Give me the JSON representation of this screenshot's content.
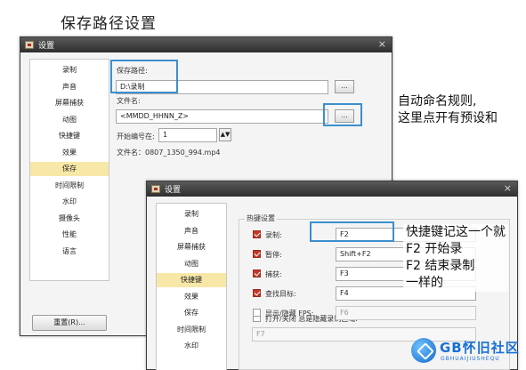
{
  "caption_top": "保存路径设置",
  "dialog1": {
    "title": "设置",
    "close": "×",
    "nav": [
      "录制",
      "声音",
      "屏幕捕获",
      "动图",
      "快捷键",
      "效果",
      "保存",
      "时间限制",
      "水印",
      "摄像头",
      "性能",
      "语言"
    ],
    "active_index": 6,
    "save_path_label": "保存路径:",
    "save_path_value": "D:\\录制",
    "filename_label": "文件名:",
    "filename_value": "<MMDD_HHNN_Z>",
    "start_number_label": "开始编号在:",
    "start_number_value": "1",
    "filename_preview": "文件名：0807_1350_994.mp4",
    "browse_label": "...",
    "reset_button": "重置(R)..."
  },
  "dialog2": {
    "title": "设置",
    "close": "×",
    "nav": [
      "录制",
      "声音",
      "屏幕捕获",
      "动图",
      "快捷键",
      "效果",
      "保存",
      "时间限制",
      "水印"
    ],
    "active_index": 4,
    "group_title": "热键设置",
    "hotkeys": [
      {
        "label": "录制:",
        "value": "F2",
        "checked": true,
        "enabled": true
      },
      {
        "label": "暂停:",
        "value": "Shift+F2",
        "checked": true,
        "enabled": true
      },
      {
        "label": "捕获:",
        "value": "F3",
        "checked": true,
        "enabled": true
      },
      {
        "label": "查找目标:",
        "value": "F4",
        "checked": true,
        "enabled": true
      },
      {
        "label": "显示/隐藏 FPS:",
        "value": "F6",
        "checked": false,
        "enabled": false
      }
    ],
    "toggle_region_label": "打开/关闭 总是隐藏录制区域:",
    "toggle_region_value": "F7"
  },
  "note_auto_naming": [
    "自动命名规则,",
    "这里点开有预设和"
  ],
  "note_hotkey": [
    "快捷键记这一个就",
    "F2  开始录",
    "F2  结束录制",
    "一样的"
  ],
  "watermark": {
    "brand": "GB怀旧社区",
    "sub": "GBHUAIJIUSHEQU"
  },
  "colors": {
    "highlight": "#3b8fd0",
    "active_nav": "#f8e8a8",
    "checkbox_on": "#c0392b"
  }
}
